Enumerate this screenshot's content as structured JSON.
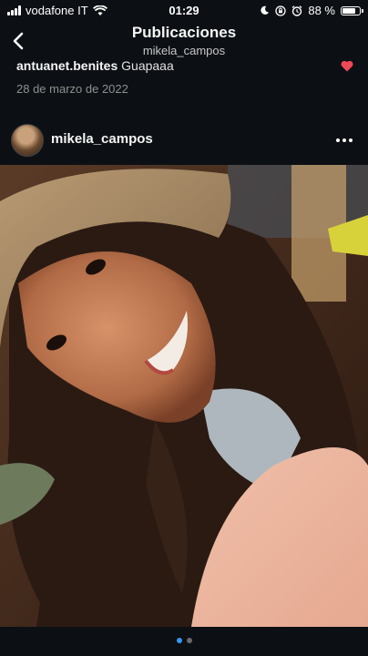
{
  "status_bar": {
    "carrier": "vodafone IT",
    "time": "01:29",
    "battery": "88 %",
    "battery_level": 0.88
  },
  "header": {
    "title": "Publicaciones",
    "subtitle": "mikela_campos"
  },
  "previous_post": {
    "comment_user": "antuanet.benites",
    "comment_text": "Guapaaa",
    "date": "28 de marzo de 2022"
  },
  "post": {
    "username": "mikela_campos",
    "carousel_total": 2,
    "carousel_active": 1
  },
  "colors": {
    "background": "#0c1014",
    "heart": "#ed4956",
    "dot_active": "#3897f0",
    "dot_inactive": "#6b6b6b"
  },
  "icons": {
    "back": "chevron-left-icon",
    "more": "more-horizontal-icon",
    "heart": "heart-icon"
  }
}
